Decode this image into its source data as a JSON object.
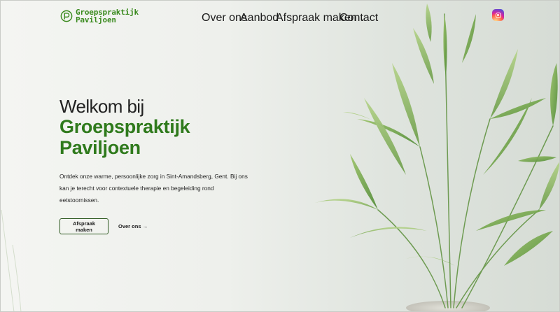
{
  "brand": {
    "line1": "Groepspraktijk",
    "line2": "Paviljoen"
  },
  "nav": {
    "items": [
      {
        "label": "Over ons"
      },
      {
        "label": "Aanbod"
      },
      {
        "label": "Afspraak maken",
        "has_dropdown": true
      },
      {
        "label": "Contact"
      }
    ]
  },
  "social": {
    "icon": "instagram-icon"
  },
  "hero": {
    "welcome": "Welkom bij",
    "name_line1": "Groepspraktijk",
    "name_line2": "Paviljoen",
    "intro": "Ontdek onze warme, persoonlijke zorg in Sint-Amandsberg, Gent. Bij ons kan je terecht voor contextuele therapie en begeleiding rond eetstoornissen.",
    "primary_cta": "Afspraak maken",
    "secondary_cta": "Over ons →"
  },
  "colors": {
    "accent": "#2f7a1c",
    "logo": "#3a8a1e",
    "button_border": "#2f5a22"
  }
}
